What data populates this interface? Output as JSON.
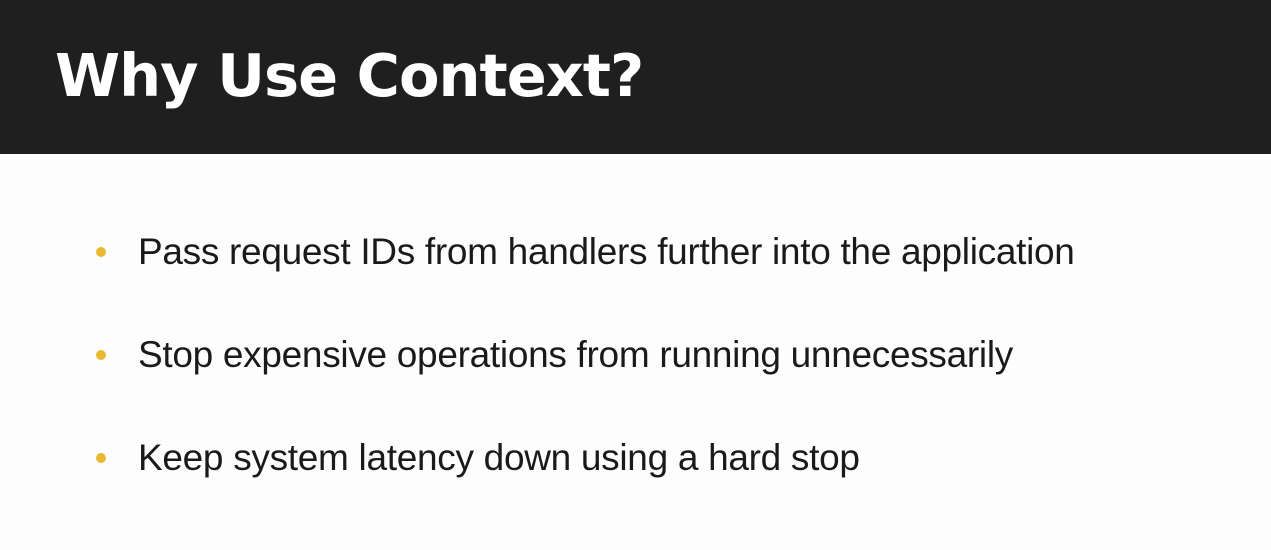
{
  "slide": {
    "title": "Why Use Context?",
    "bullets": [
      "Pass request IDs from handlers further into the application",
      "Stop expensive operations from running unnecessarily",
      "Keep system latency down using a hard stop"
    ]
  },
  "colors": {
    "header_background": "#1f1f1f",
    "title_text": "#ffffff",
    "bullet_accent": "#e8b931",
    "body_text": "#1a1a1a",
    "page_background": "#fdfdfd"
  }
}
